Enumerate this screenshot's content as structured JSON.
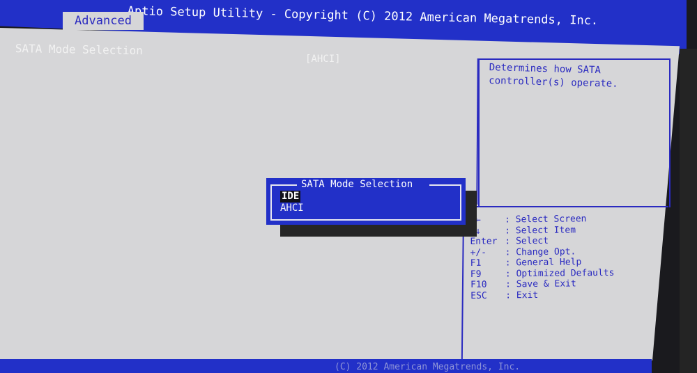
{
  "window": {
    "title": "Aptio Setup Utility - Copyright (C) 2012 American Megatrends, Inc."
  },
  "tabs": [
    {
      "label": "Advanced",
      "active": true
    }
  ],
  "settings": [
    {
      "label": "SATA Mode Selection",
      "value": "[AHCI]"
    }
  ],
  "help": {
    "description": "Determines how SATA controller(s) operate."
  },
  "keys": [
    {
      "key": "→←",
      "action": ": Select Screen"
    },
    {
      "key": "↑↓",
      "action": ": Select Item"
    },
    {
      "key": "Enter",
      "action": ": Select"
    },
    {
      "key": "+/-",
      "action": ": Change Opt."
    },
    {
      "key": "F1",
      "action": ": General Help"
    },
    {
      "key": "F9",
      "action": ": Optimized Defaults"
    },
    {
      "key": "F10",
      "action": ": Save & Exit"
    },
    {
      "key": "ESC",
      "action": ": Exit"
    }
  ],
  "popup": {
    "title": "SATA Mode Selection",
    "options": [
      {
        "label": "IDE",
        "highlighted": true
      },
      {
        "label": "AHCI",
        "highlighted": false
      }
    ]
  },
  "footer": {
    "text": "(C) 2012 American Megatrends, Inc."
  },
  "colors": {
    "bios_blue": "#2230c8",
    "panel_grey": "#d6d6d8",
    "text_blue": "#2a2ac0"
  }
}
